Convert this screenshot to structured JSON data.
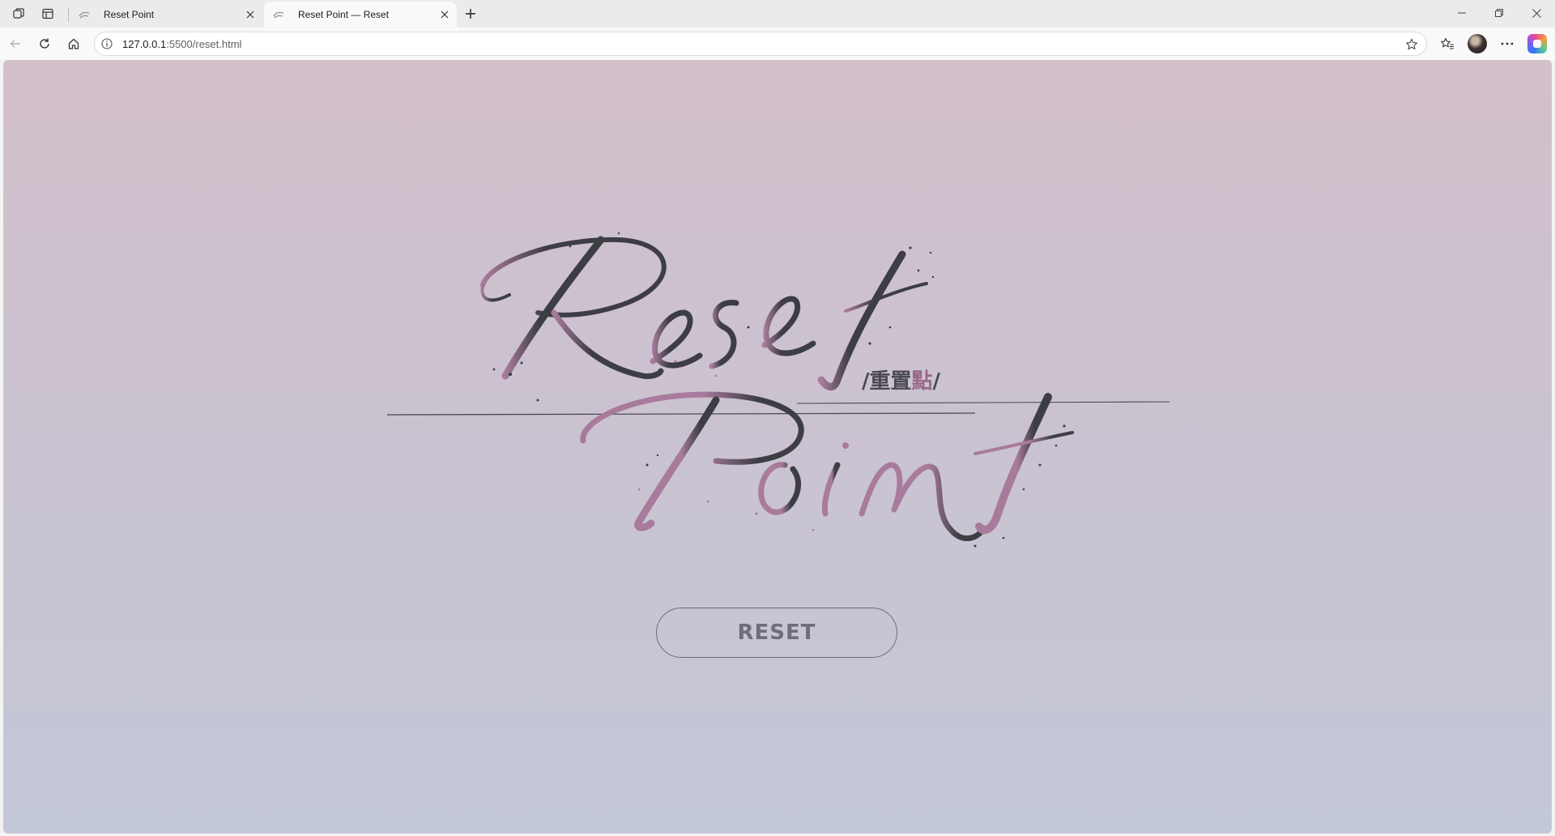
{
  "browser": {
    "tabs": [
      {
        "title": "Reset Point",
        "active": false
      },
      {
        "title": "Reset Point — Reset",
        "active": true
      }
    ],
    "address": {
      "host": "127.0.0.1",
      "path": ":5500/reset.html"
    }
  },
  "page": {
    "logo": {
      "word1": "Reset",
      "word2": "Point",
      "subtitle_prefix": "/重置",
      "subtitle_accent": "點",
      "subtitle_suffix": "/"
    },
    "reset_button_label": "RESET"
  },
  "colors": {
    "background_top": "#d2c0cb",
    "background_bottom": "#c3c8d7",
    "ink_dark": "#3d3d44",
    "ink_pink": "#a87b9c",
    "button_text": "#6e6e78"
  }
}
